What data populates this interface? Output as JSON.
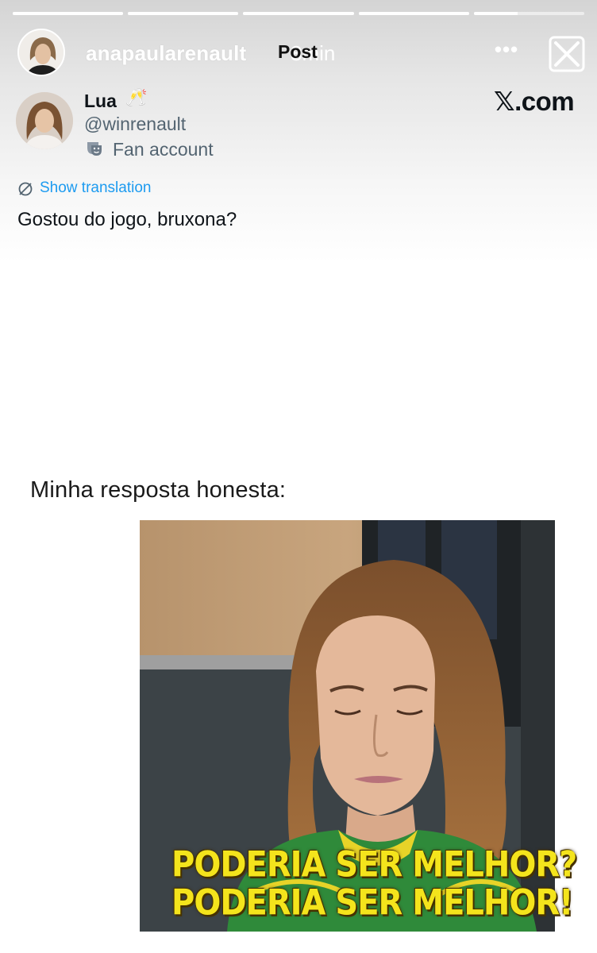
{
  "story": {
    "username": "anapaularenault",
    "time": "8min",
    "overlay_label": "Post",
    "progress": [
      1,
      1,
      1,
      1,
      0.4
    ],
    "more_label": "•••"
  },
  "tweet": {
    "name": "Lua",
    "name_emoji": "champagne-icon",
    "handle": "@winrenault",
    "label": "Fan account",
    "label_icon": "theater-mask-icon",
    "brand": "𝕏.com",
    "translate_label": "Show translation",
    "text": "Gostou do jogo, bruxona?"
  },
  "caption": "Minha resposta honesta:",
  "meme": {
    "line1": "PODERIA SER MELHOR?",
    "line2": "PODERIA SER MELHOR!"
  },
  "colors": {
    "link": "#1d9bf0",
    "subtitle": "#f4e41c",
    "secondary_text": "#536471"
  }
}
